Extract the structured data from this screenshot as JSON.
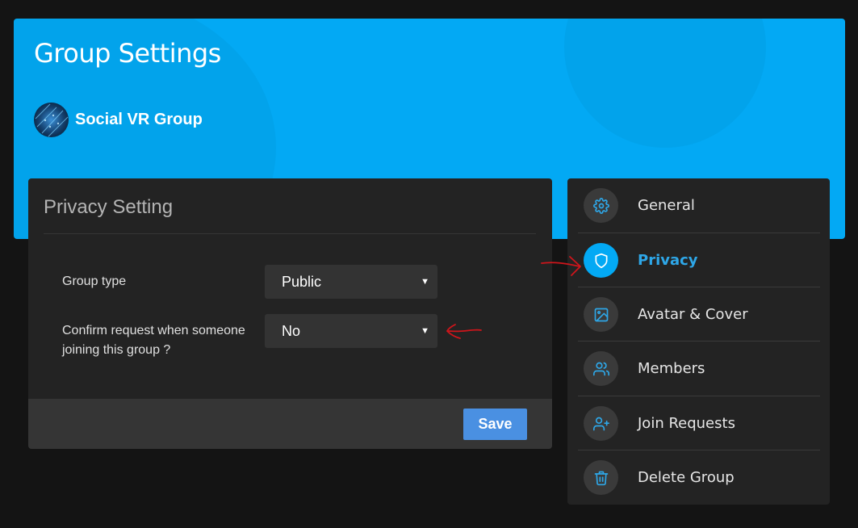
{
  "header": {
    "title": "Group Settings",
    "group_name": "Social VR Group"
  },
  "privacy_card": {
    "title": "Privacy Setting",
    "fields": [
      {
        "label": "Group type",
        "value": "Public"
      },
      {
        "label": "Confirm request when someone joining this group ?",
        "value": "No"
      }
    ],
    "save_label": "Save"
  },
  "nav": {
    "items": [
      {
        "label": "General",
        "icon": "gear-icon",
        "active": false
      },
      {
        "label": "Privacy",
        "icon": "shield-icon",
        "active": true
      },
      {
        "label": "Avatar & Cover",
        "icon": "image-icon",
        "active": false
      },
      {
        "label": "Members",
        "icon": "users-icon",
        "active": false
      },
      {
        "label": "Join Requests",
        "icon": "user-plus-icon",
        "active": false
      },
      {
        "label": "Delete Group",
        "icon": "trash-icon",
        "active": false
      }
    ]
  },
  "colors": {
    "accent": "#03a9f4",
    "background": "#141414",
    "card": "#232323",
    "save_button": "#4a90e2",
    "annotation": "#d0151b"
  }
}
